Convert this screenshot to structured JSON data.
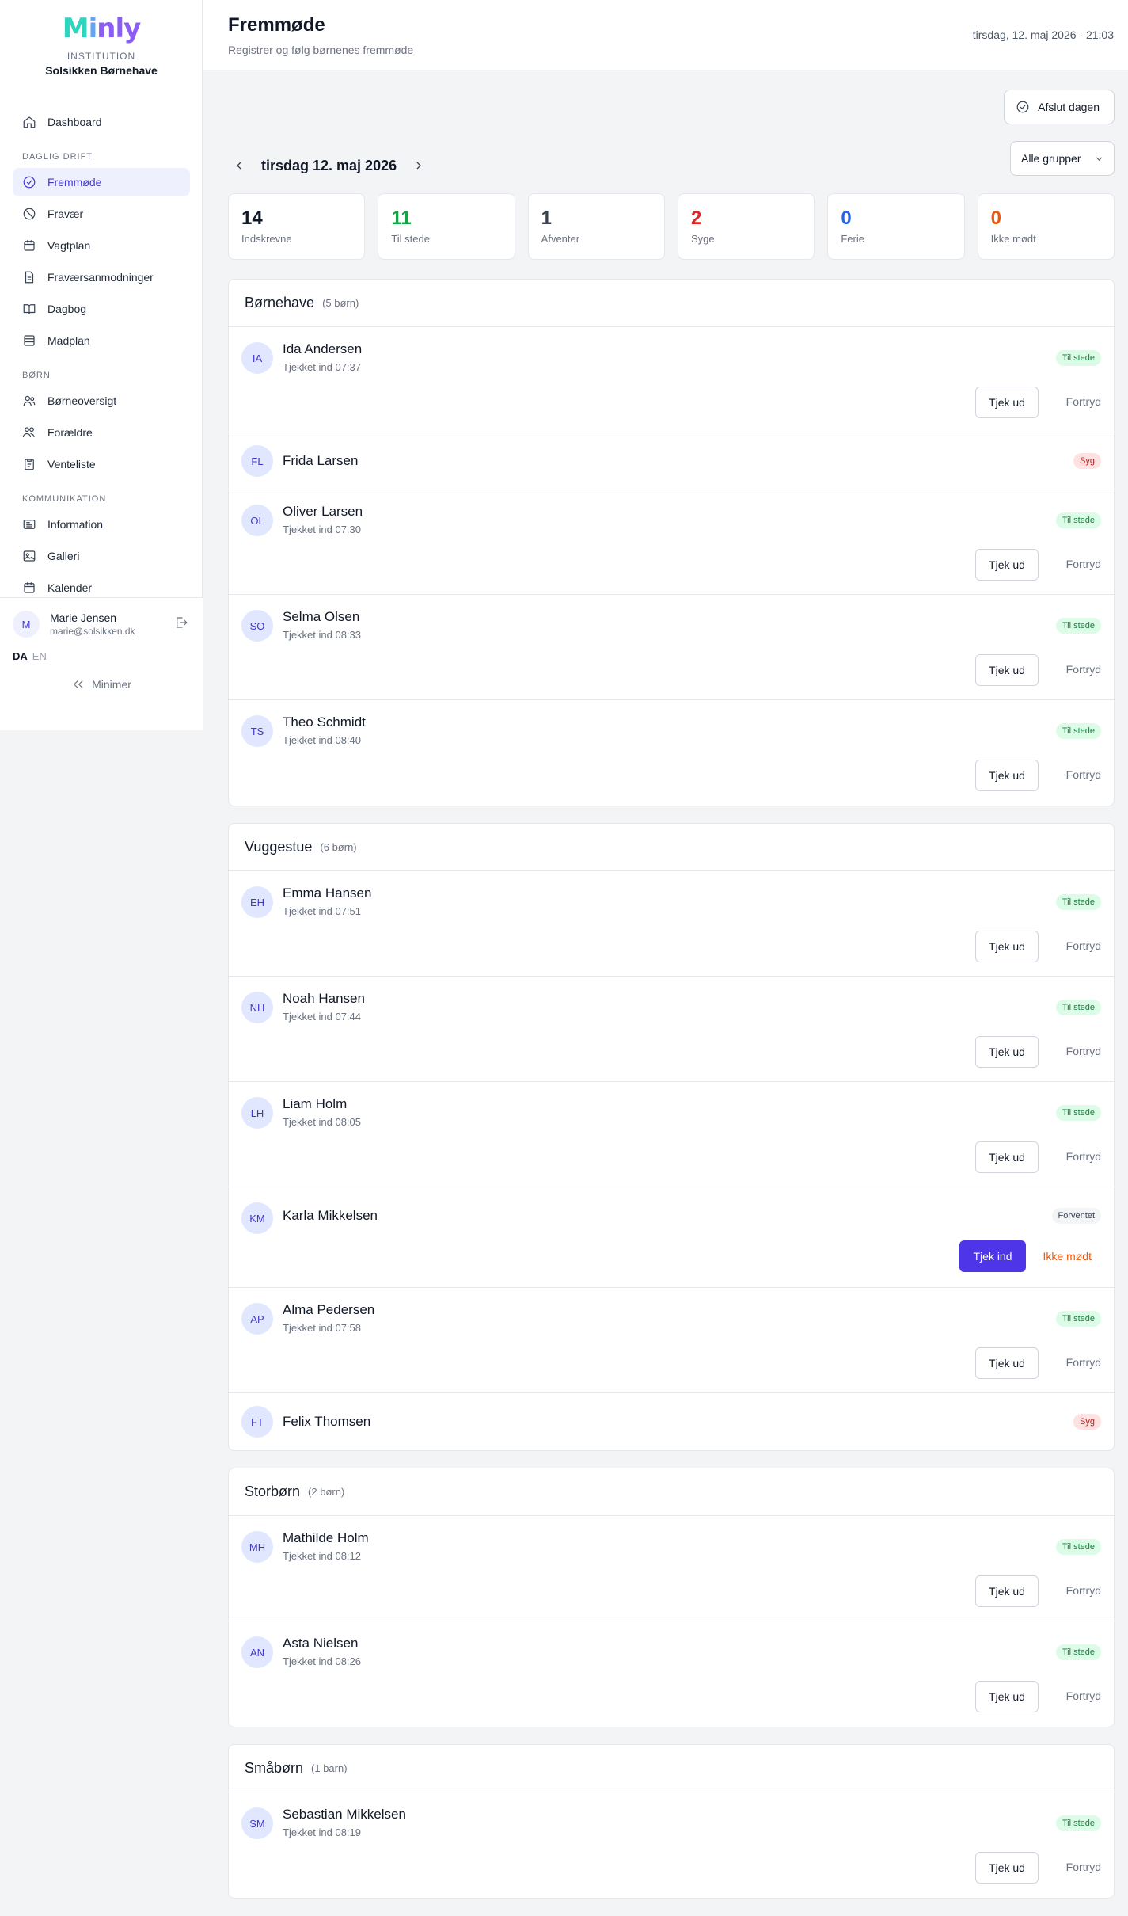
{
  "logo": {
    "text": "Minly"
  },
  "sidebar": {
    "institution_kicker": "INSTITUTION",
    "institution_name": "Solsikken Børnehave",
    "dashboard": "Dashboard",
    "section_daily": "DAGLIG DRIFT",
    "daily": [
      "Fremmøde",
      "Fravær",
      "Vagtplan",
      "Fraværsanmodninger",
      "Dagbog",
      "Madplan"
    ],
    "section_children": "BØRN",
    "children": [
      "Børneoversigt",
      "Forældre",
      "Venteliste"
    ],
    "section_comm": "KOMMUNIKATION",
    "comm": [
      "Information",
      "Galleri",
      "Kalender"
    ],
    "user": {
      "initial": "M",
      "name": "Marie Jensen",
      "email": "marie@solsikken.dk"
    },
    "lang_da": "DA",
    "lang_en": "EN",
    "minimize": "Minimer"
  },
  "header": {
    "title": "Fremmøde",
    "subtitle": "Registrer og følg børnenes fremmøde",
    "datetime": "tirsdag, 12. maj 2026 · 21:03"
  },
  "main": {
    "close_day": "Afslut dagen",
    "date_label": "tirsdag 12. maj 2026",
    "group_filter": "Alle grupper"
  },
  "stats": [
    {
      "value": "14",
      "label": "Indskrevne",
      "color": "#111827"
    },
    {
      "value": "11",
      "label": "Til stede",
      "color": "#16a34a"
    },
    {
      "value": "1",
      "label": "Afventer",
      "color": "#374151"
    },
    {
      "value": "2",
      "label": "Syge",
      "color": "#dc2626"
    },
    {
      "value": "0",
      "label": "Ferie",
      "color": "#2563eb"
    },
    {
      "value": "0",
      "label": "Ikke mødt",
      "color": "#ea580c"
    }
  ],
  "labels": {
    "present": "Til stede",
    "sick": "Syg",
    "expected": "Forventet",
    "check_out": "Tjek ud",
    "undo": "Fortryd",
    "check_in": "Tjek ind",
    "absent": "Ikke mødt"
  },
  "groups": [
    {
      "name": "Børnehave",
      "count": "(5 børn)",
      "children": [
        {
          "initials": "IA",
          "name": "Ida Andersen",
          "checkin": "Tjekket ind 07:37"
        },
        {
          "initials": "FL",
          "name": "Frida Larsen"
        },
        {
          "initials": "OL",
          "name": "Oliver Larsen",
          "checkin": "Tjekket ind 07:30"
        },
        {
          "initials": "SO",
          "name": "Selma Olsen",
          "checkin": "Tjekket ind 08:33"
        },
        {
          "initials": "TS",
          "name": "Theo Schmidt",
          "checkin": "Tjekket ind 08:40"
        }
      ]
    },
    {
      "name": "Vuggestue",
      "count": "(6 børn)",
      "children": [
        {
          "initials": "EH",
          "name": "Emma Hansen",
          "checkin": "Tjekket ind 07:51"
        },
        {
          "initials": "NH",
          "name": "Noah Hansen",
          "checkin": "Tjekket ind 07:44"
        },
        {
          "initials": "LH",
          "name": "Liam Holm",
          "checkin": "Tjekket ind 08:05"
        },
        {
          "initials": "KM",
          "name": "Karla Mikkelsen"
        },
        {
          "initials": "AP",
          "name": "Alma Pedersen",
          "checkin": "Tjekket ind 07:58"
        },
        {
          "initials": "FT",
          "name": "Felix Thomsen"
        }
      ]
    },
    {
      "name": "Storbørn",
      "count": "(2 børn)",
      "children": [
        {
          "initials": "MH",
          "name": "Mathilde Holm",
          "checkin": "Tjekket ind 08:12"
        },
        {
          "initials": "AN",
          "name": "Asta Nielsen",
          "checkin": "Tjekket ind 08:26"
        }
      ]
    },
    {
      "name": "Småbørn",
      "count": "(1 barn)",
      "children": [
        {
          "initials": "SM",
          "name": "Sebastian Mikkelsen",
          "checkin": "Tjekket ind 08:19"
        }
      ]
    }
  ]
}
